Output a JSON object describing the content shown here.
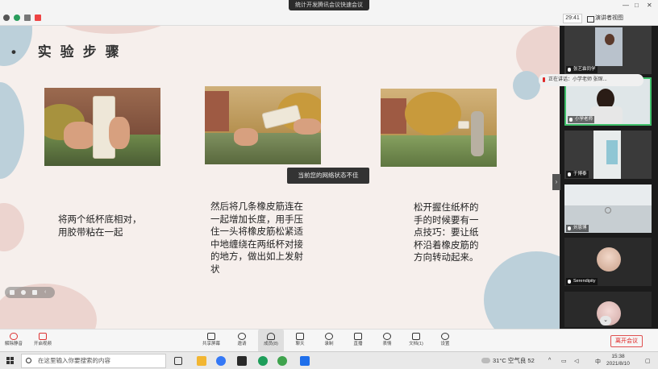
{
  "window": {
    "title": "统计开发腾讯会议快速会议",
    "timer": "29:41",
    "view_label": "演讲者视图",
    "minimize": "—",
    "maximize": "□",
    "close": "✕"
  },
  "slide": {
    "title": "实验步骤",
    "captions": [
      "将两个纸杯底相对，\n用胶带粘在一起",
      "然后将几条橡皮筋连在\n一起增加长度，用手压\n住一头将橡皮筋松紧适\n中地缠绕在两纸杯对接\n的地方，做出如上发射\n状",
      "松开握住纸杯的\n手的时候要有一\n点技巧：要让纸\n杯沿着橡皮筋的\n方向转动起来。"
    ],
    "toast": "当前您的网络状态不佳",
    "colors": {
      "background": "#f6efec",
      "blob_blue": "#bcd0da",
      "blob_pink": "#ecd4cf"
    }
  },
  "participants": {
    "speaking_label": "正在讲话：小学老师 张琛...",
    "tiles": [
      {
        "name": "张艺霖同学"
      },
      {
        "name": "小学老师"
      },
      {
        "name": "于博泰"
      },
      {
        "name": "刘恩博"
      },
      {
        "name": "Serendipity"
      },
      {
        "name": ""
      }
    ],
    "collapse_glyph": "›",
    "scroll_glyph": "⌄"
  },
  "toolbar": {
    "items": [
      {
        "label": "解除静音",
        "icon": "microphone-muted-icon"
      },
      {
        "label": "开启视频",
        "icon": "camera-off-icon"
      },
      {
        "label": "共享屏幕",
        "icon": "share-screen-icon"
      },
      {
        "label": "邀请",
        "icon": "invite-icon"
      },
      {
        "label": "成员(8)",
        "icon": "members-icon"
      },
      {
        "label": "聊天",
        "icon": "chat-icon"
      },
      {
        "label": "录制",
        "icon": "record-icon"
      },
      {
        "label": "直播",
        "icon": "live-icon"
      },
      {
        "label": "表情",
        "icon": "emoji-icon"
      },
      {
        "label": "文档(1)",
        "icon": "document-icon"
      },
      {
        "label": "设置",
        "icon": "settings-icon"
      }
    ],
    "leave_label": "离开会议"
  },
  "taskbar": {
    "search_placeholder": "在这里输入你要搜索的内容",
    "weather": "31°C  空气良 52",
    "ime": "中",
    "time": "15:38",
    "date": "2021/8/10",
    "app_colors": [
      "#2a2a2a",
      "#f2b632",
      "#3478f6",
      "#1e9e5a",
      "#3fa34d",
      "#1f6feb"
    ]
  }
}
